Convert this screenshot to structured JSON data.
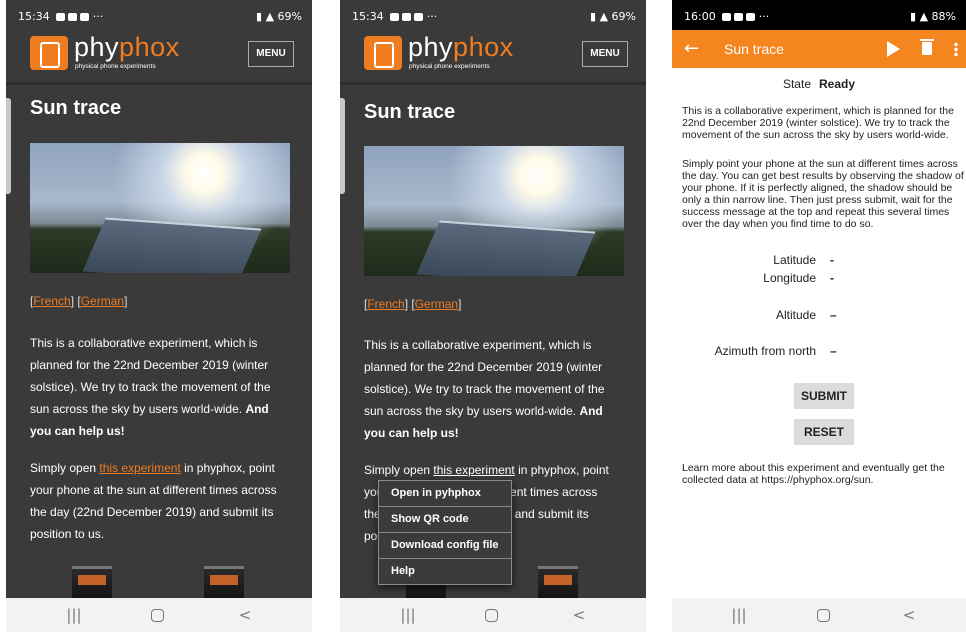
{
  "screens": [
    {
      "status": {
        "time": "15:34",
        "extra": "···",
        "signal": "69%"
      },
      "logo": {
        "text_a": "phy",
        "text_b": "phox",
        "subtitle": "physical phone experiments"
      },
      "menu_label": "MENU",
      "title": "Sun trace",
      "lang": {
        "french": "French",
        "german": "German"
      },
      "para1": {
        "text": "This is a collaborative experiment, which is planned for the 22nd December 2019 (winter solstice). We try to track the movement of the sun across the sky by users world-wide.",
        "bold": "And you can help us!"
      },
      "para2": {
        "pre": "Simply open",
        "link": "this experiment",
        "post": "in phyphox, point your phone at the sun at different times across the day (22nd December 2019) and submit its position to us."
      }
    },
    {
      "status": {
        "time": "15:34",
        "extra": "···",
        "signal": "69%"
      },
      "logo": {
        "text_a": "phy",
        "text_b": "phox",
        "subtitle": "physical phone experiments"
      },
      "menu_label": "MENU",
      "title": "Sun trace",
      "lang": {
        "french": "French",
        "german": "German"
      },
      "para1": {
        "text": "This is a collaborative experiment, which is planned for the 22nd December 2019 (winter solstice). We try to track the movement of the sun across the sky by users world-wide.",
        "bold": "And you can help us!"
      },
      "para2": {
        "pre": "Simply open",
        "link": "this experiment",
        "post": "in phyphox, point",
        "line2": "you",
        "line2b": "erent times across",
        "line3": "the",
        "line3b": "9) and submit its",
        "line4": "pos"
      },
      "context_menu": [
        "Open in pyhphox",
        "Show QR code",
        "Download config file",
        "Help"
      ]
    },
    {
      "status": {
        "time": "16:00",
        "extra": "···",
        "signal": "88%"
      },
      "appbar_title": "Sun trace",
      "back_glyph": "←",
      "state_label": "State",
      "state_value": "Ready",
      "info1": "This is a collaborative experiment, which is planned for the 22nd December 2019 (winter solstice). We try to track the movement of the sun across the sky by users world-wide.",
      "info2": "Simply point your phone at the sun at different times across the day. You can get best results by observing the shadow of your phone. If it is perfectly aligned, the shadow should be only a thin narrow line. Then just press submit, wait for the success message at the top and repeat this several times over the day when you find time to do so.",
      "fields": [
        {
          "label": "Latitude",
          "value": "-"
        },
        {
          "label": "Longitude",
          "value": "-"
        },
        {
          "label": "Altitude",
          "value": "–"
        },
        {
          "label": "Azimuth from north",
          "value": "–"
        }
      ],
      "submit_label": "SUBMIT",
      "reset_label": "RESET",
      "info3": "Learn more about this experiment and eventually get the collected data at https://phyphox.org/sun."
    }
  ],
  "navbar": {
    "recents": "|||",
    "back": "<"
  },
  "colors": {
    "accent": "#f07c20",
    "appbar": "#f5861f",
    "page_bg": "#3a3a3a"
  }
}
